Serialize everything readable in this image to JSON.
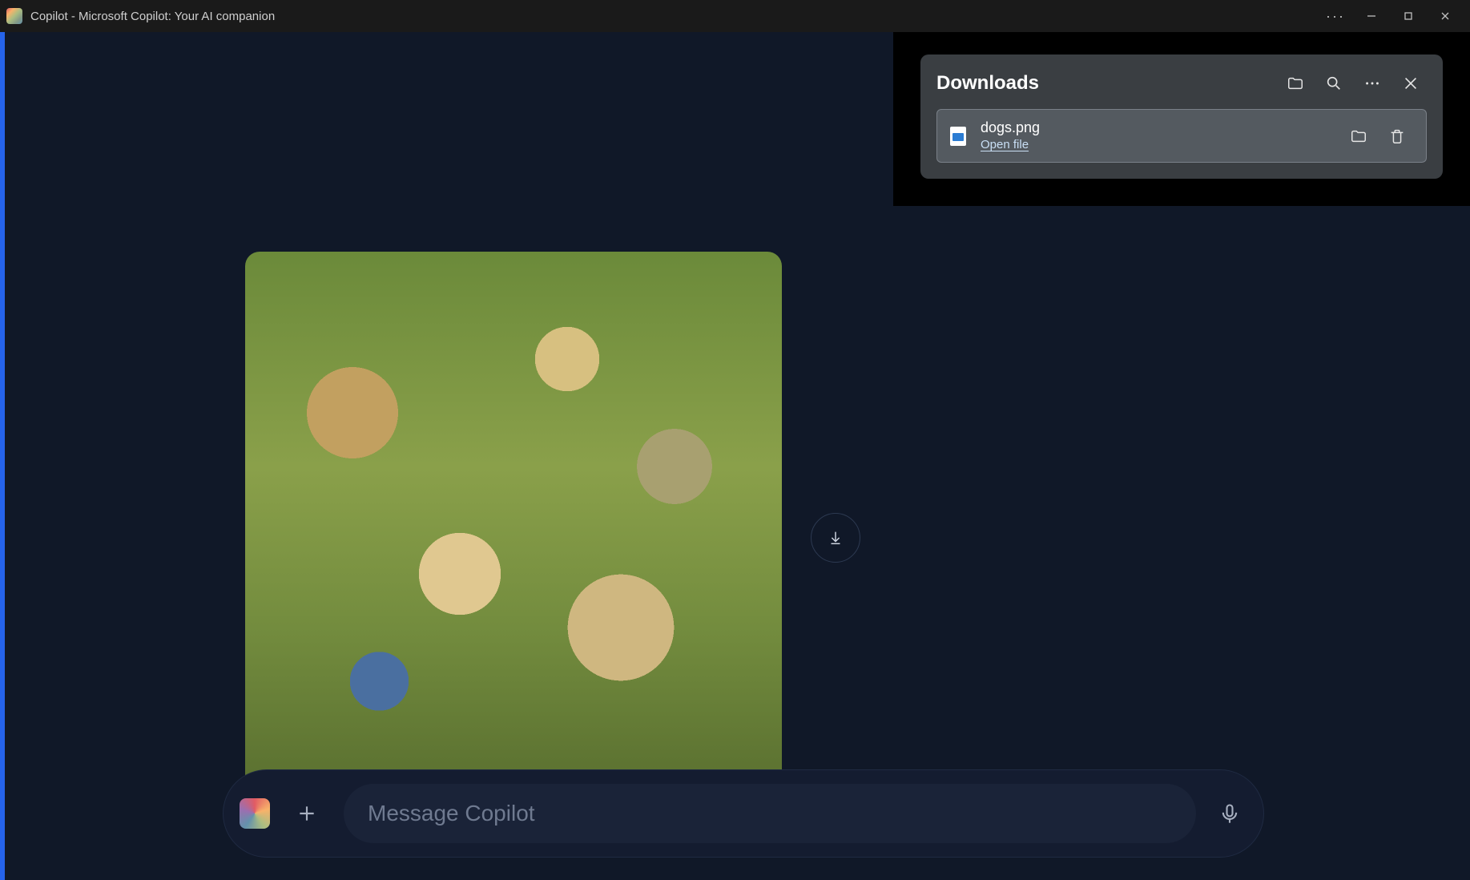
{
  "window": {
    "title": "Copilot - Microsoft Copilot: Your AI companion"
  },
  "composer": {
    "placeholder": "Message Copilot"
  },
  "downloads": {
    "title": "Downloads",
    "items": [
      {
        "filename": "dogs.png",
        "action_label": "Open file"
      }
    ]
  }
}
